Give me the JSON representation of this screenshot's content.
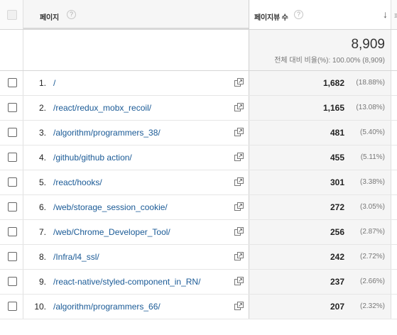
{
  "header": {
    "page_col_label": "페이지",
    "page_col_help": "?",
    "views_col_label": "페이지뷰 수",
    "views_col_help": "?",
    "sort_arrow": "↓",
    "next_col_label": "페"
  },
  "totals": {
    "value": "8,909",
    "subtext": "전체 대비 비율(%): 100.00% (8,909)"
  },
  "rows": [
    {
      "rank": "1.",
      "page": "/",
      "views": "1,682",
      "pct": "(18.88%)"
    },
    {
      "rank": "2.",
      "page": "/react/redux_mobx_recoil/",
      "views": "1,165",
      "pct": "(13.08%)"
    },
    {
      "rank": "3.",
      "page": "/algorithm/programmers_38/",
      "views": "481",
      "pct": "(5.40%)"
    },
    {
      "rank": "4.",
      "page": "/github/github action/",
      "views": "455",
      "pct": "(5.11%)"
    },
    {
      "rank": "5.",
      "page": "/react/hooks/",
      "views": "301",
      "pct": "(3.38%)"
    },
    {
      "rank": "6.",
      "page": "/web/storage_session_cookie/",
      "views": "272",
      "pct": "(3.05%)"
    },
    {
      "rank": "7.",
      "page": "/web/Chrome_Developer_Tool/",
      "views": "256",
      "pct": "(2.87%)"
    },
    {
      "rank": "8.",
      "page": "/Infra/l4_ssl/",
      "views": "242",
      "pct": "(2.72%)"
    },
    {
      "rank": "9.",
      "page": "/react-native/styled-component_in_RN/",
      "views": "237",
      "pct": "(2.66%)"
    },
    {
      "rank": "10.",
      "page": "/algorithm/programmers_66/",
      "views": "207",
      "pct": "(2.32%)"
    }
  ],
  "icons": {
    "row_external": "open-in-new-window-icon",
    "help": "help-circle-icon"
  },
  "colors": {
    "link": "#1a5a96",
    "metric_bg": "#f5f5f5"
  }
}
